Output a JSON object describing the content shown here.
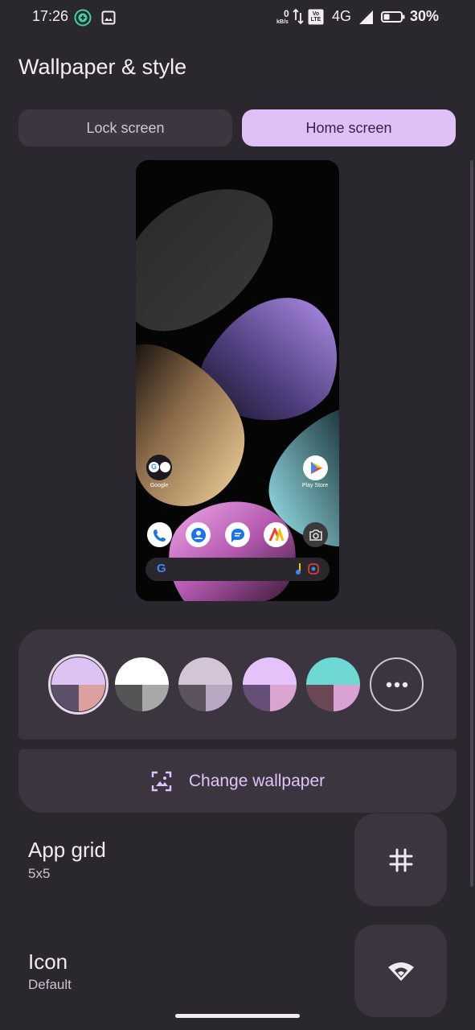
{
  "status_bar": {
    "time": "17:26",
    "data_speed_value": "0",
    "data_speed_unit": "kB/s",
    "volte": "Vo LTE",
    "network": "4G",
    "battery": "30%"
  },
  "page": {
    "title": "Wallpaper & style"
  },
  "tabs": [
    {
      "label": "Lock screen",
      "selected": false
    },
    {
      "label": "Home screen",
      "selected": true
    }
  ],
  "preview": {
    "apps_row": [
      {
        "label": "Google",
        "icon": "google-folder-icon"
      },
      {
        "label": "Play Store",
        "icon": "play-store-icon"
      }
    ],
    "dock": [
      "phone-icon",
      "contacts-icon",
      "messages-icon",
      "news-icon",
      "camera-icon"
    ],
    "search_bar_icons": [
      "google-g-icon",
      "music-search-icon",
      "lens-icon"
    ]
  },
  "palettes": {
    "selected_index": 0,
    "options": [
      {
        "top": "#dcc3f4",
        "bottom_left": "#5d5169",
        "bottom_right": "#dca09e"
      },
      {
        "top": "#ffffff",
        "bottom_left": "#555555",
        "bottom_right": "#a8a8a8"
      },
      {
        "top": "#d3c4d6",
        "bottom_left": "#5b5360",
        "bottom_right": "#b8a8c2"
      },
      {
        "top": "#e5c2fa",
        "bottom_left": "#654e77",
        "bottom_right": "#d9a4cf"
      },
      {
        "top": "#6ed8d2",
        "bottom_left": "#6a4955",
        "bottom_right": "#d8a2d3"
      }
    ],
    "more_icon": "more-horiz-icon"
  },
  "change_wallpaper": {
    "label": "Change wallpaper",
    "icon": "wallpaper-icon"
  },
  "app_grid": {
    "title": "App grid",
    "value": "5x5",
    "icon": "grid-icon"
  },
  "icon_setting": {
    "title": "Icon",
    "value": "Default",
    "icon": "icon-shape-icon"
  },
  "colors": {
    "accent": "#e0c1f7",
    "background": "#2b272e",
    "card": "#3a353e"
  }
}
